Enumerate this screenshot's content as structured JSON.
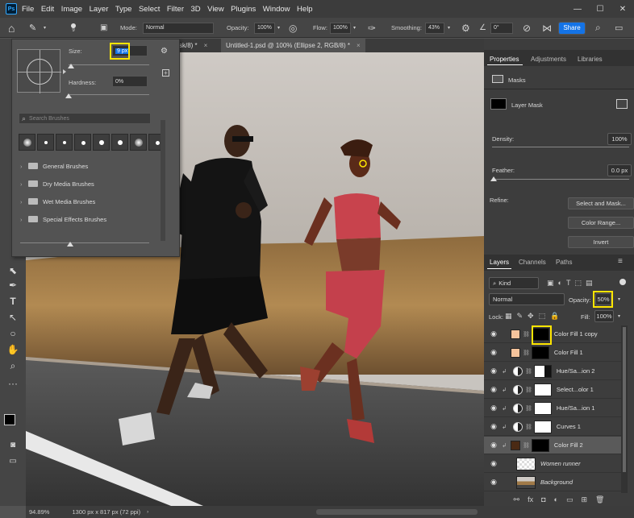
{
  "menu": {
    "logo": "Ps",
    "items": [
      "File",
      "Edit",
      "Image",
      "Layer",
      "Type",
      "Select",
      "Filter",
      "3D",
      "View",
      "Plugins",
      "Window",
      "Help"
    ],
    "minimize": "—",
    "maximize": "☐",
    "close": "✕"
  },
  "options": {
    "brush_size_small": "9",
    "mode_label": "Mode:",
    "mode_value": "Normal",
    "opacity_label": "Opacity:",
    "opacity_value": "100%",
    "flow_label": "Flow:",
    "flow_value": "100%",
    "smoothing_label": "Smoothing:",
    "smoothing_value": "43%",
    "angle_value": "0°",
    "share_label": "Share"
  },
  "tabs": [
    {
      "label": "sk/8) *",
      "close": "×"
    },
    {
      "label": "Untitled-1.psd @ 100% (Ellipse 2, RGB/8) *",
      "close": "×"
    }
  ],
  "brush_panel": {
    "size_label": "Size:",
    "size_value": "9 px",
    "hardness_label": "Hardness:",
    "hardness_value": "0%",
    "search_placeholder": "Search Brushes",
    "folders": [
      "General Brushes",
      "Dry Media Brushes",
      "Wet Media Brushes",
      "Special Effects Brushes"
    ],
    "size_fraction": 0.03,
    "hardness_fraction": 0.0
  },
  "properties": {
    "tabs": [
      "Properties",
      "Adjustments",
      "Libraries"
    ],
    "masks_label": "Masks",
    "layer_mask_label": "Layer Mask",
    "density_label": "Density:",
    "density_value": "100%",
    "feather_label": "Feather:",
    "feather_value": "0.0 px",
    "refine_label": "Refine:",
    "select_mask_btn": "Select and Mask...",
    "color_range_btn": "Color Range...",
    "invert_btn": "Invert"
  },
  "layers_panel": {
    "tabs": [
      "Layers",
      "Channels",
      "Paths"
    ],
    "kind_value": "Kind",
    "blend_value": "Normal",
    "opacity_label": "Opacity:",
    "opacity_value": "50%",
    "lock_label": "Lock:",
    "fill_label": "Fill:",
    "fill_value": "100%",
    "layers": [
      {
        "name": "Color Fill 1 copy",
        "thumb": "#f6c49c",
        "mask": "black",
        "selected": false,
        "clipped": false
      },
      {
        "name": "Color Fill 1",
        "thumb": "#f6c49c",
        "mask": "black",
        "selected": false,
        "clipped": false
      },
      {
        "name": "Hue/Sa...ion 2",
        "thumb": "adj",
        "mask": "white-dark",
        "selected": false,
        "clipped": true
      },
      {
        "name": "Select...olor 1",
        "thumb": "adj",
        "mask": "white",
        "selected": false,
        "clipped": true
      },
      {
        "name": "Hue/Sa...ion 1",
        "thumb": "adj",
        "mask": "white",
        "selected": false,
        "clipped": true
      },
      {
        "name": "Curves 1",
        "thumb": "adj",
        "mask": "white",
        "selected": false,
        "clipped": true
      },
      {
        "name": "Color Fill 2",
        "thumb": "#4a2a14",
        "mask": "black",
        "selected": true,
        "clipped": true
      },
      {
        "name": "Women runner",
        "thumb": "checker",
        "mask": "",
        "selected": false,
        "clipped": false
      },
      {
        "name": "Background",
        "thumb": "photo",
        "mask": "",
        "selected": false,
        "clipped": false
      }
    ]
  },
  "status": {
    "zoom": "94.89%",
    "doc_info": "1300 px x 817 px (72 ppi)"
  },
  "colors": {
    "accent": "#1473e6",
    "highlight": "#ffe500"
  }
}
